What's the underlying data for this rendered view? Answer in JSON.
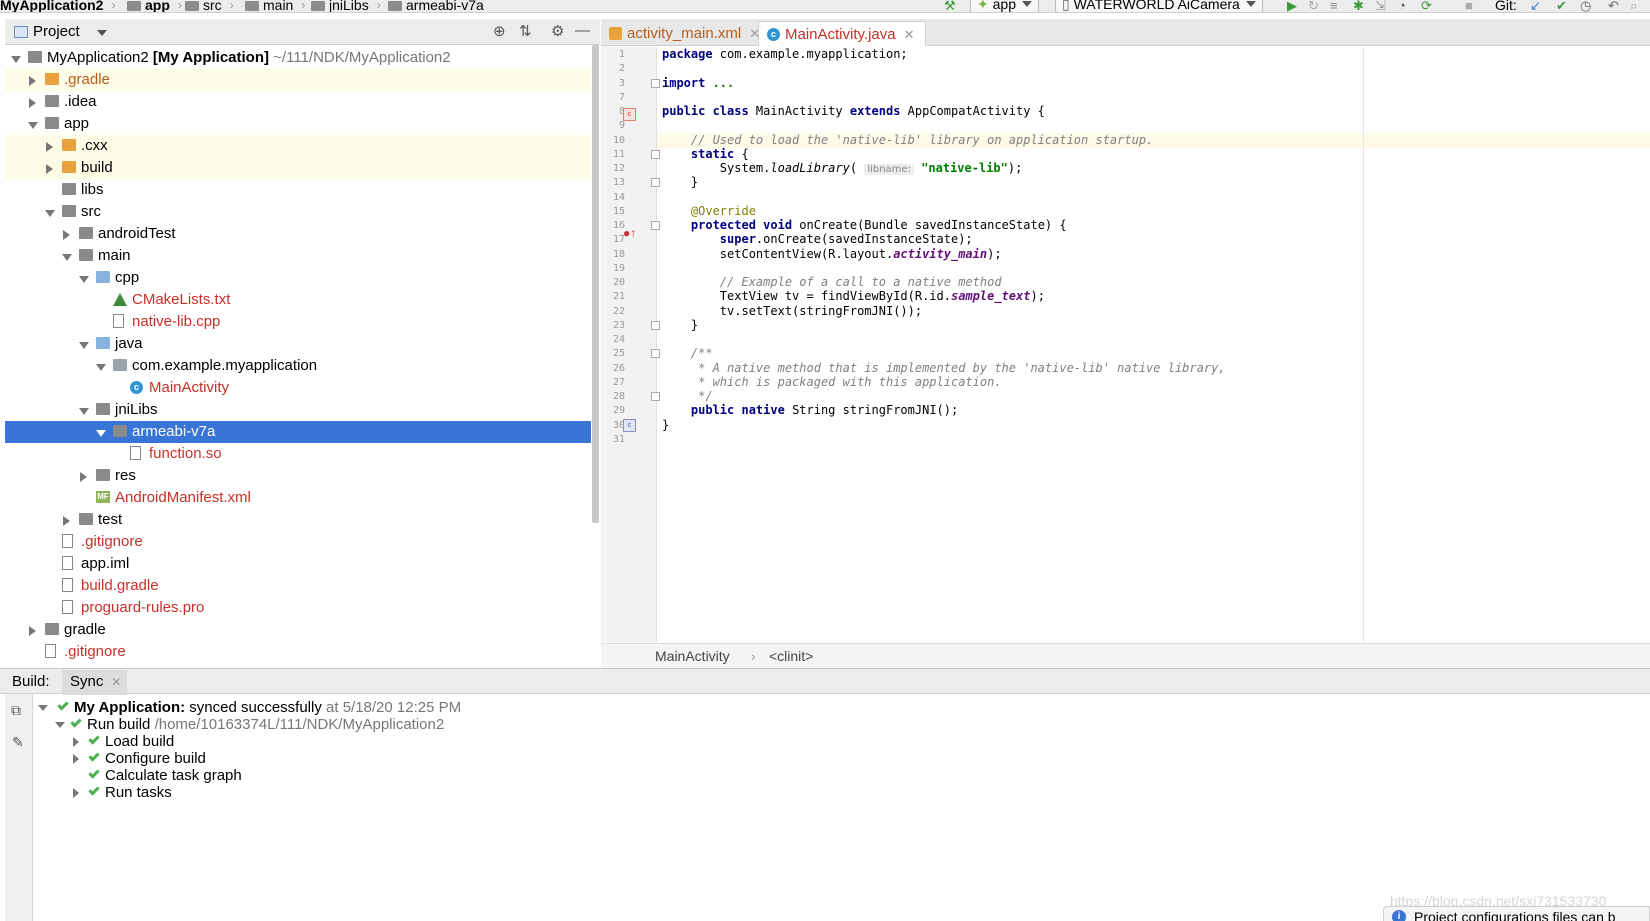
{
  "breadcrumb": [
    {
      "label": "MyApplication2",
      "bold": true
    },
    {
      "label": "app",
      "bold": true
    },
    {
      "label": "src"
    },
    {
      "label": "main"
    },
    {
      "label": "jniLibs"
    },
    {
      "label": "armeabi-v7a"
    }
  ],
  "toolbar": {
    "run_config": "app",
    "device": "WATERWORLD AiCamera",
    "git_label": "Git:"
  },
  "project_panel": {
    "title": "Project"
  },
  "tree": [
    {
      "label": "MyApplication2",
      "module": "[My Application]",
      "path": "~/111/NDK/MyApplication2",
      "depth": 0,
      "state": "open",
      "icon": "module-folder-icon"
    },
    {
      "label": ".gradle",
      "depth": 1,
      "state": "closed",
      "icon": "folder-excluded-icon",
      "color": "orange",
      "highlight": true
    },
    {
      "label": ".idea",
      "depth": 1,
      "state": "closed",
      "icon": "folder-icon"
    },
    {
      "label": "app",
      "depth": 1,
      "state": "open",
      "icon": "module-folder-icon"
    },
    {
      "label": ".cxx",
      "depth": 2,
      "state": "closed",
      "icon": "folder-excluded-icon",
      "highlight": true
    },
    {
      "label": "build",
      "depth": 2,
      "state": "closed",
      "icon": "folder-excluded-icon",
      "highlight": true
    },
    {
      "label": "libs",
      "depth": 2,
      "state": "none",
      "icon": "folder-icon"
    },
    {
      "label": "src",
      "depth": 2,
      "state": "open",
      "icon": "folder-icon"
    },
    {
      "label": "androidTest",
      "depth": 3,
      "state": "closed",
      "icon": "folder-icon"
    },
    {
      "label": "main",
      "depth": 3,
      "state": "open",
      "icon": "folder-icon"
    },
    {
      "label": "cpp",
      "depth": 4,
      "state": "open",
      "icon": "source-folder-icon"
    },
    {
      "label": "CMakeLists.txt",
      "depth": 5,
      "state": "none",
      "icon": "cmake-icon",
      "color": "red"
    },
    {
      "label": "native-lib.cpp",
      "depth": 5,
      "state": "none",
      "icon": "cpp-file-icon",
      "color": "red"
    },
    {
      "label": "java",
      "depth": 4,
      "state": "open",
      "icon": "source-folder-icon"
    },
    {
      "label": "com.example.myapplication",
      "depth": 5,
      "state": "open",
      "icon": "package-icon"
    },
    {
      "label": "MainActivity",
      "depth": 6,
      "state": "none",
      "icon": "class-icon",
      "color": "red"
    },
    {
      "label": "jniLibs",
      "depth": 4,
      "state": "open",
      "icon": "folder-icon"
    },
    {
      "label": "armeabi-v7a",
      "depth": 5,
      "state": "open",
      "icon": "folder-icon",
      "selected": true
    },
    {
      "label": "function.so",
      "depth": 6,
      "state": "none",
      "icon": "so-file-icon",
      "color": "red"
    },
    {
      "label": "res",
      "depth": 4,
      "state": "closed",
      "icon": "res-folder-icon"
    },
    {
      "label": "AndroidManifest.xml",
      "depth": 4,
      "state": "none",
      "icon": "manifest-icon",
      "color": "red"
    },
    {
      "label": "test",
      "depth": 3,
      "state": "closed",
      "icon": "folder-icon"
    },
    {
      "label": ".gitignore",
      "depth": 2,
      "state": "none",
      "icon": "text-file-icon",
      "color": "red"
    },
    {
      "label": "app.iml",
      "depth": 2,
      "state": "none",
      "icon": "iml-file-icon"
    },
    {
      "label": "build.gradle",
      "depth": 2,
      "state": "none",
      "icon": "gradle-icon",
      "color": "red"
    },
    {
      "label": "proguard-rules.pro",
      "depth": 2,
      "state": "none",
      "icon": "text-file-icon",
      "color": "red"
    },
    {
      "label": "gradle",
      "depth": 1,
      "state": "closed",
      "icon": "folder-icon"
    },
    {
      "label": ".gitignore",
      "depth": 1,
      "state": "none",
      "icon": "text-file-icon",
      "color": "red"
    }
  ],
  "editor": {
    "tabs": [
      {
        "label": "activity_main.xml",
        "active": false,
        "icon": "xml-file-icon"
      },
      {
        "label": "MainActivity.java",
        "active": true,
        "icon": "class-icon"
      }
    ],
    "line_numbers": [
      "1",
      "2",
      "3",
      "7",
      "8",
      "9",
      "10",
      "11",
      "12",
      "13",
      "14",
      "15",
      "16",
      "17",
      "18",
      "19",
      "20",
      "21",
      "22",
      "23",
      "24",
      "25",
      "26",
      "27",
      "28",
      "29",
      "30",
      "31"
    ],
    "lines": [
      [
        {
          "t": "package",
          "c": "kw"
        },
        {
          "t": " com.example.myapplication;"
        }
      ],
      [],
      [
        {
          "t": "import",
          "c": "kw"
        },
        {
          "t": " ...",
          "c": "str"
        }
      ],
      [],
      [
        {
          "t": "public class ",
          "c": "kw"
        },
        {
          "t": "MainActivity "
        },
        {
          "t": "extends ",
          "c": "kw"
        },
        {
          "t": "AppCompatActivity {"
        }
      ],
      [],
      [
        {
          "t": "    // Used to load the 'native-lib' library on application startup.",
          "c": "cm"
        }
      ],
      [
        {
          "t": "    "
        },
        {
          "t": "static",
          "c": "kw"
        },
        {
          "t": " {"
        }
      ],
      [
        {
          "t": "        System."
        },
        {
          "t": "loadLibrary",
          "c": "it"
        },
        {
          "t": "( "
        },
        {
          "t": "libname:",
          "c": "hint"
        },
        {
          "t": " "
        },
        {
          "t": "\"native-lib\"",
          "c": "str"
        },
        {
          "t": ");"
        }
      ],
      [
        {
          "t": "    }"
        }
      ],
      [],
      [
        {
          "t": "    @Override",
          "c": "an"
        }
      ],
      [
        {
          "t": "    "
        },
        {
          "t": "protected void ",
          "c": "kw"
        },
        {
          "t": "onCreate(Bundle savedInstanceState) {"
        }
      ],
      [
        {
          "t": "        "
        },
        {
          "t": "super",
          "c": "kw"
        },
        {
          "t": ".onCreate(savedInstanceState);"
        }
      ],
      [
        {
          "t": "        setContentView(R.layout."
        },
        {
          "t": "activity_main",
          "c": "fld"
        },
        {
          "t": ");"
        }
      ],
      [],
      [
        {
          "t": "        // Example of a call to a native method",
          "c": "cm"
        }
      ],
      [
        {
          "t": "        TextView tv = findViewById(R.id."
        },
        {
          "t": "sample_text",
          "c": "fld"
        },
        {
          "t": ");"
        }
      ],
      [
        {
          "t": "        tv.setText(stringFromJNI());"
        }
      ],
      [
        {
          "t": "    }"
        }
      ],
      [],
      [
        {
          "t": "    /**",
          "c": "cm"
        }
      ],
      [
        {
          "t": "     * A native method that is implemented by the 'native-lib' native library,",
          "c": "cm"
        }
      ],
      [
        {
          "t": "     * which is packaged with this application.",
          "c": "cm"
        }
      ],
      [
        {
          "t": "     */",
          "c": "cm"
        }
      ],
      [
        {
          "t": "    "
        },
        {
          "t": "public native ",
          "c": "kw"
        },
        {
          "t": "String stringFromJNI();"
        }
      ],
      [
        {
          "t": "}"
        }
      ],
      []
    ],
    "status_class": "MainActivity",
    "status_sep": "›",
    "status_member": "<clinit>"
  },
  "build": {
    "label": "Build:",
    "tab": "Sync",
    "root_name": "My Application:",
    "root_status": "synced successfully",
    "root_time": "at 5/18/20 12:25 PM",
    "run_build": "Run build",
    "run_build_path": "/home/10163374L/111/NDK/MyApplication2",
    "steps": [
      {
        "label": "Load build",
        "expandable": true
      },
      {
        "label": "Configure build",
        "expandable": true
      },
      {
        "label": "Calculate task graph",
        "expandable": false
      },
      {
        "label": "Run tasks",
        "expandable": true
      }
    ]
  },
  "notification": {
    "text": "Project configurations files can b"
  },
  "watermark": "https://blog.csdn.net/sxj731533730",
  "colors": {
    "selection": "#3875d7",
    "keyword": "#000080",
    "string": "#008000",
    "comment": "#808080",
    "success": "#4caf50",
    "vcs_modified_red": "#c7302a"
  }
}
